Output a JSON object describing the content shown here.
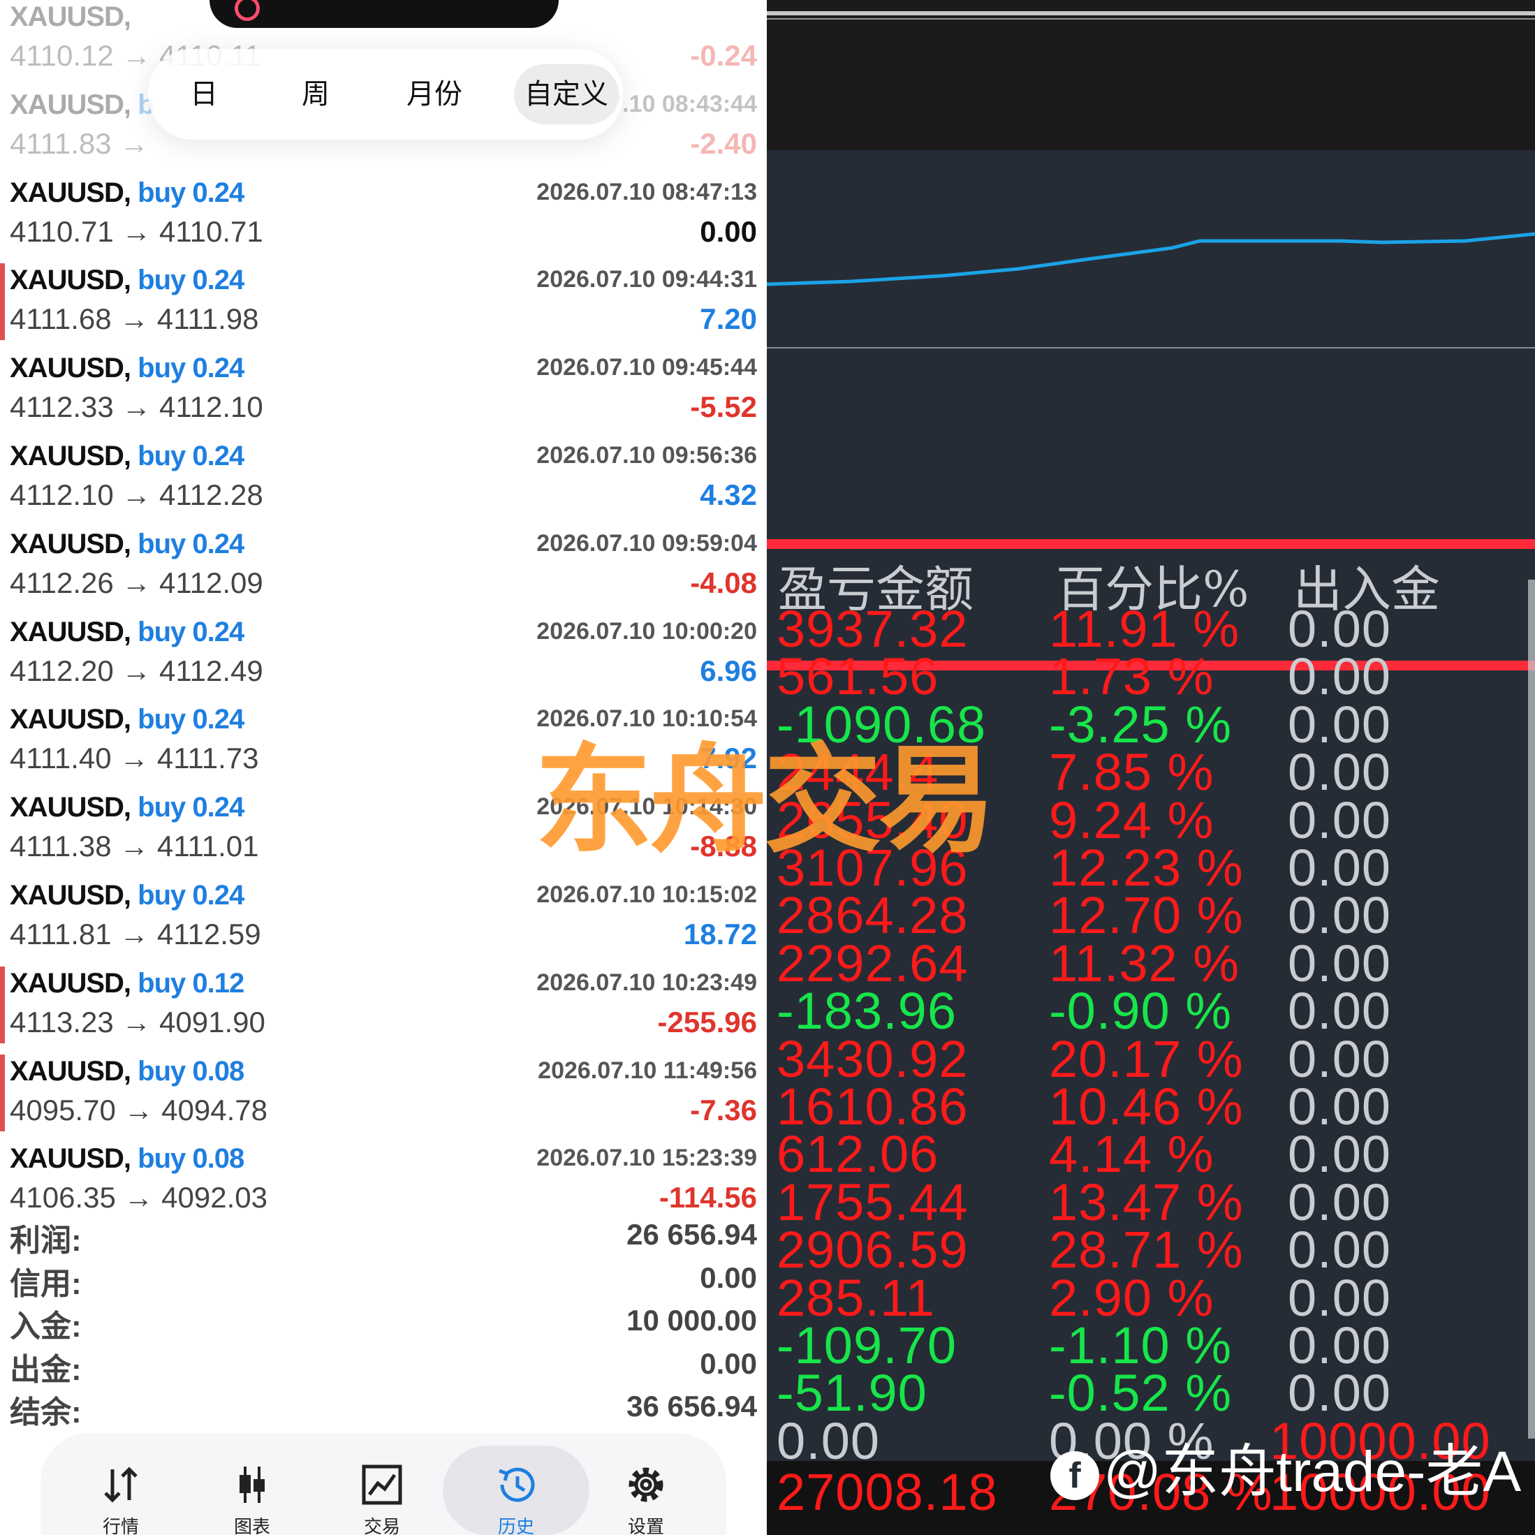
{
  "filter_tabs": [
    "日",
    "周",
    "月份",
    "自定义"
  ],
  "filter_active": 3,
  "trades": [
    {
      "symbol": "XAUUSD,",
      "side": "",
      "time": "",
      "price": "4110.12 → 4110.11",
      "profit": "-0.24",
      "sign": "neg",
      "faded": true,
      "mark": false
    },
    {
      "symbol": "XAUUSD,",
      "side": "b",
      "time": "7.10 08:43:44",
      "price": "4111.83 →",
      "profit": "-2.40",
      "sign": "neg",
      "faded": true,
      "mark": false
    },
    {
      "symbol": "XAUUSD,",
      "side": "buy 0.24",
      "time": "2026.07.10 08:47:13",
      "price": "4110.71 → 4110.71",
      "profit": "0.00",
      "sign": "zero",
      "faded": false,
      "mark": false
    },
    {
      "symbol": "XAUUSD,",
      "side": "buy 0.24",
      "time": "2026.07.10 09:44:31",
      "price": "4111.68 → 4111.98",
      "profit": "7.20",
      "sign": "pos",
      "faded": false,
      "mark": true
    },
    {
      "symbol": "XAUUSD,",
      "side": "buy 0.24",
      "time": "2026.07.10 09:45:44",
      "price": "4112.33 → 4112.10",
      "profit": "-5.52",
      "sign": "neg",
      "faded": false,
      "mark": false
    },
    {
      "symbol": "XAUUSD,",
      "side": "buy 0.24",
      "time": "2026.07.10 09:56:36",
      "price": "4112.10 → 4112.28",
      "profit": "4.32",
      "sign": "pos",
      "faded": false,
      "mark": false
    },
    {
      "symbol": "XAUUSD,",
      "side": "buy 0.24",
      "time": "2026.07.10 09:59:04",
      "price": "4112.26 → 4112.09",
      "profit": "-4.08",
      "sign": "neg",
      "faded": false,
      "mark": false
    },
    {
      "symbol": "XAUUSD,",
      "side": "buy 0.24",
      "time": "2026.07.10 10:00:20",
      "price": "4112.20 → 4112.49",
      "profit": "6.96",
      "sign": "pos",
      "faded": false,
      "mark": false
    },
    {
      "symbol": "XAUUSD,",
      "side": "buy 0.24",
      "time": "2026.07.10 10:10:54",
      "price": "4111.40 → 4111.73",
      "profit": "7.92",
      "sign": "pos",
      "faded": false,
      "mark": false
    },
    {
      "symbol": "XAUUSD,",
      "side": "buy 0.24",
      "time": "2026.07.10 10:14:30",
      "price": "4111.38 → 4111.01",
      "profit": "-8.88",
      "sign": "neg",
      "faded": false,
      "mark": false
    },
    {
      "symbol": "XAUUSD,",
      "side": "buy 0.24",
      "time": "2026.07.10 10:15:02",
      "price": "4111.81 → 4112.59",
      "profit": "18.72",
      "sign": "pos",
      "faded": false,
      "mark": false
    },
    {
      "symbol": "XAUUSD,",
      "side": "buy 0.12",
      "time": "2026.07.10 10:23:49",
      "price": "4113.23 → 4091.90",
      "profit": "-255.96",
      "sign": "neg",
      "faded": false,
      "mark": true
    },
    {
      "symbol": "XAUUSD,",
      "side": "buy 0.08",
      "time": "2026.07.10 11:49:56",
      "price": "4095.70 → 4094.78",
      "profit": "-7.36",
      "sign": "neg",
      "faded": false,
      "mark": true
    },
    {
      "symbol": "XAUUSD,",
      "side": "buy 0.08",
      "time": "2026.07.10 15:23:39",
      "price": "4106.35 → 4092.03",
      "profit": "-114.56",
      "sign": "neg",
      "faded": false,
      "mark": false
    }
  ],
  "summary": [
    {
      "label": "利润:",
      "value": "26 656.94"
    },
    {
      "label": "信用:",
      "value": "0.00"
    },
    {
      "label": "入金:",
      "value": "10 000.00"
    },
    {
      "label": "出金:",
      "value": "0.00"
    },
    {
      "label": "结余:",
      "value": "36 656.94"
    }
  ],
  "nav": [
    {
      "label": "行情",
      "icon": "quotes-icon"
    },
    {
      "label": "图表",
      "icon": "candlestick-icon"
    },
    {
      "label": "交易",
      "icon": "trade-icon"
    },
    {
      "label": "历史",
      "icon": "history-icon"
    },
    {
      "label": "设置",
      "icon": "settings-icon"
    }
  ],
  "nav_active": 3,
  "report": {
    "headers": [
      "盈亏金额",
      "百分比%",
      "出入金"
    ],
    "rows": [
      {
        "pl": "3937.32",
        "pct": "11.91 %",
        "flow": "0.00",
        "pl_color": "r",
        "pct_color": "r"
      },
      {
        "pl": "561.56",
        "pct": "1.73 %",
        "flow": "0.00",
        "pl_color": "r",
        "pct_color": "r"
      },
      {
        "pl": "-1090.68",
        "pct": "-3.25 %",
        "flow": "0.00",
        "pl_color": "g",
        "pct_color": "g"
      },
      {
        "pl": "2444.4",
        "pct": "7.85 %",
        "flow": "0.00",
        "pl_color": "r",
        "pct_color": "r"
      },
      {
        "pl": "2655.40",
        "pct": "9.24 %",
        "flow": "0.00",
        "pl_color": "r",
        "pct_color": "r"
      },
      {
        "pl": "3107.96",
        "pct": "12.23 %",
        "flow": "0.00",
        "pl_color": "r",
        "pct_color": "r"
      },
      {
        "pl": "2864.28",
        "pct": "12.70 %",
        "flow": "0.00",
        "pl_color": "r",
        "pct_color": "r"
      },
      {
        "pl": "2292.64",
        "pct": "11.32 %",
        "flow": "0.00",
        "pl_color": "r",
        "pct_color": "r"
      },
      {
        "pl": "-183.96",
        "pct": "-0.90 %",
        "flow": "0.00",
        "pl_color": "g",
        "pct_color": "g"
      },
      {
        "pl": "3430.92",
        "pct": "20.17 %",
        "flow": "0.00",
        "pl_color": "r",
        "pct_color": "r"
      },
      {
        "pl": "1610.86",
        "pct": "10.46 %",
        "flow": "0.00",
        "pl_color": "r",
        "pct_color": "r"
      },
      {
        "pl": "612.06",
        "pct": "4.14 %",
        "flow": "0.00",
        "pl_color": "r",
        "pct_color": "r"
      },
      {
        "pl": "1755.44",
        "pct": "13.47 %",
        "flow": "0.00",
        "pl_color": "r",
        "pct_color": "r"
      },
      {
        "pl": "2906.59",
        "pct": "28.71 %",
        "flow": "0.00",
        "pl_color": "r",
        "pct_color": "r"
      },
      {
        "pl": "285.11",
        "pct": "2.90 %",
        "flow": "0.00",
        "pl_color": "r",
        "pct_color": "r"
      },
      {
        "pl": "-109.70",
        "pct": "-1.10 %",
        "flow": "0.00",
        "pl_color": "g",
        "pct_color": "g"
      },
      {
        "pl": "-51.90",
        "pct": "-0.52 %",
        "flow": "0.00",
        "pl_color": "g",
        "pct_color": "g"
      },
      {
        "pl": "0.00",
        "pct": "0.00 %",
        "flow": "10000.00",
        "pl_color": "w",
        "pct_color": "w",
        "flow_color": "r"
      }
    ],
    "total": {
      "pl": "27008.18",
      "pct": "270.08 %",
      "flow": "10000.00"
    }
  },
  "watermark": "东舟交易",
  "credit": "@东舟trade-老A",
  "colors": {
    "profit_pos": "#1e7fe0",
    "profit_neg": "#e0342c",
    "report_red": "#ff1a1a",
    "report_green": "#17e64a",
    "equity_line": "#1aa3e8",
    "watermark": "#ff9a2e"
  }
}
